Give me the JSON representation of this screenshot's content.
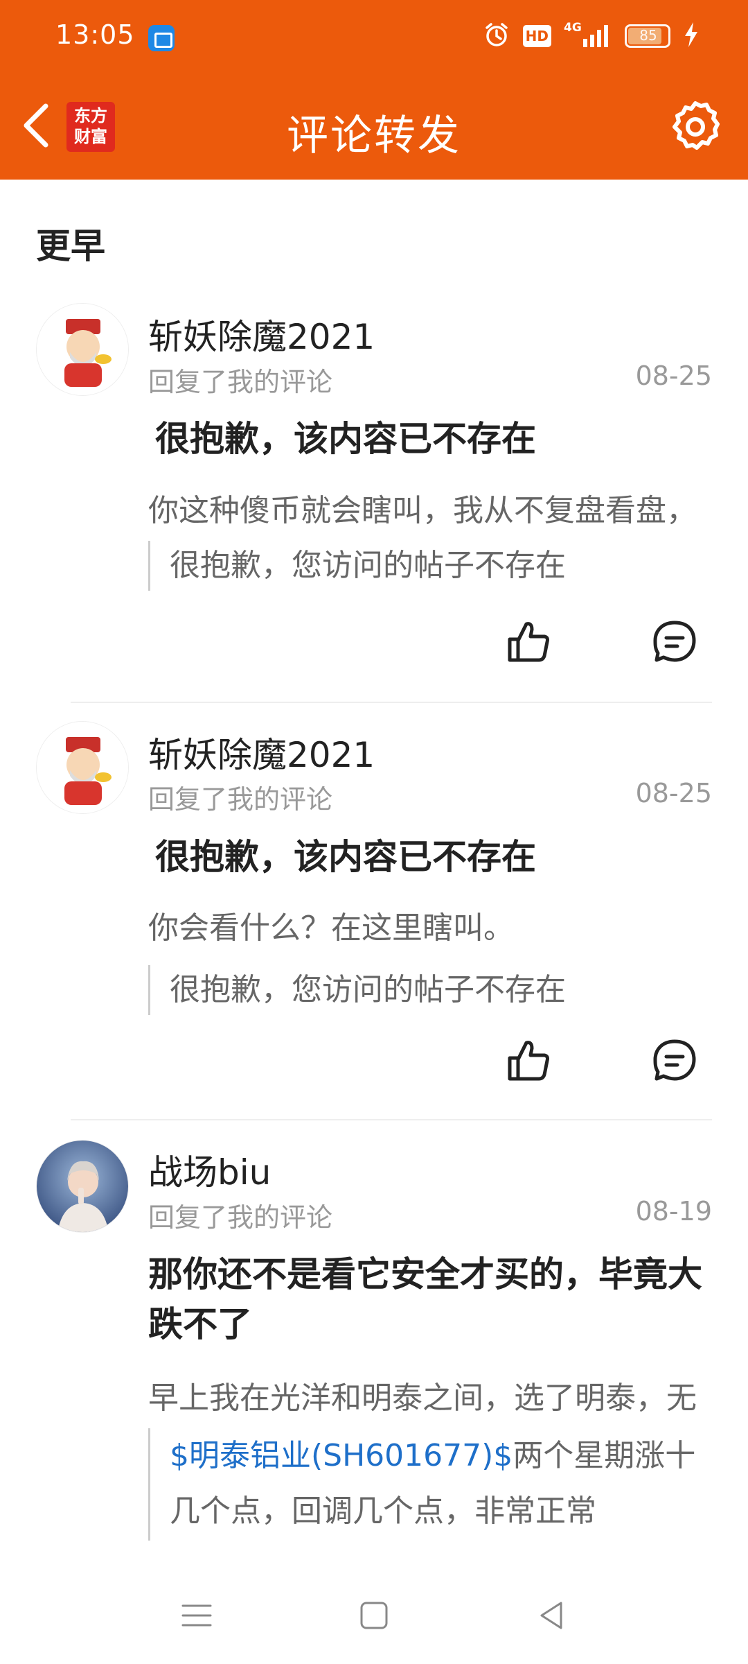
{
  "status_bar": {
    "time": "13:05",
    "battery": "85",
    "network": "4G",
    "hd": "HD",
    "icons": [
      "app-notification-icon",
      "alarm-icon",
      "hd-icon",
      "signal-icon",
      "battery-icon",
      "charging-icon"
    ]
  },
  "nav": {
    "title": "评论转发",
    "logo_line1": "东方",
    "logo_line2": "财富",
    "back_icon": "chevron-left-icon",
    "settings_icon": "gear-icon"
  },
  "section_title": "更早",
  "items": [
    {
      "username": "斩妖除魔2021",
      "action": "回复了我的评论",
      "date": "08-25",
      "content": "很抱歉，该内容已不存在",
      "reply": "你这种傻币就会瞎叫，我从不复盘看盘，",
      "quote": "很抱歉，您访问的帖子不存在"
    },
    {
      "username": "斩妖除魔2021",
      "action": "回复了我的评论",
      "date": "08-25",
      "content": "很抱歉，该内容已不存在",
      "reply": "你会看什么？在这里瞎叫。",
      "quote": "很抱歉，您访问的帖子不存在"
    },
    {
      "username": "战场biu",
      "action": "回复了我的评论",
      "date": "08-19",
      "content": "那你还不是看它安全才买的，毕竟大跌不了",
      "reply": "早上我在光洋和明泰之间，选了明泰，无",
      "quote_stock": "$明泰铝业(SH601677)$",
      "quote_rest": "两个星期涨十几个点，回调几个点，非常正常"
    }
  ],
  "bottom_nav": {
    "icons": [
      "menu-icon",
      "home-icon",
      "back-icon"
    ]
  },
  "colors": {
    "brand": "#EC5A0C",
    "link": "#1E6FC9"
  }
}
